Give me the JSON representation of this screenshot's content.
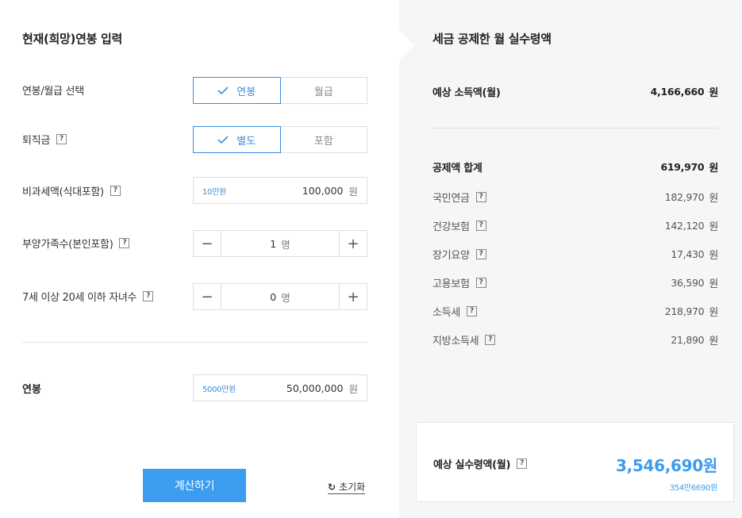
{
  "input": {
    "title": "현재(희망)연봉 입력",
    "pay_type": {
      "label": "연봉/월급 선택",
      "options": [
        "연봉",
        "월급"
      ],
      "selected": "연봉"
    },
    "severance": {
      "label": "퇴직금",
      "options": [
        "별도",
        "포함"
      ],
      "selected": "별도"
    },
    "nontax": {
      "label": "비과세액(식대포함)",
      "hint": "10만원",
      "value": "100,000",
      "unit": "원"
    },
    "dependents": {
      "label": "부양가족수(본인포함)",
      "value": "1",
      "unit": "명",
      "minus": "−",
      "plus": "+"
    },
    "children": {
      "label": "7세 이상 20세 이하 자녀수",
      "value": "0",
      "unit": "명",
      "minus": "−",
      "plus": "+"
    },
    "salary": {
      "label": "연봉",
      "hint": "5000만원",
      "value": "50,000,000",
      "unit": "원"
    },
    "calc_button": "계산하기",
    "reset_button": "초기화",
    "help_glyph": "?"
  },
  "result": {
    "title": "세금 공제한 월 실수령액",
    "monthly_income": {
      "label": "예상 소득액(월)",
      "value": "4,166,660",
      "unit": "원"
    },
    "deduction_total": {
      "label": "공제액 합계",
      "value": "619,970",
      "unit": "원"
    },
    "deductions": [
      {
        "label": "국민연금",
        "value": "182,970",
        "unit": "원"
      },
      {
        "label": "건강보험",
        "value": "142,120",
        "unit": "원"
      },
      {
        "label": "장기요양",
        "value": "17,430",
        "unit": "원"
      },
      {
        "label": "고용보험",
        "value": "36,590",
        "unit": "원"
      },
      {
        "label": "소득세",
        "value": "218,970",
        "unit": "원"
      },
      {
        "label": "지방소득세",
        "value": "21,890",
        "unit": "원"
      }
    ],
    "net": {
      "label": "예상 실수령액(월)",
      "amount": "3,546,690원",
      "sub": "354만6690원"
    }
  },
  "colors": {
    "accent": "#3b9cf0",
    "panel_bg": "#f5f6f8",
    "border": "#dddddd"
  }
}
